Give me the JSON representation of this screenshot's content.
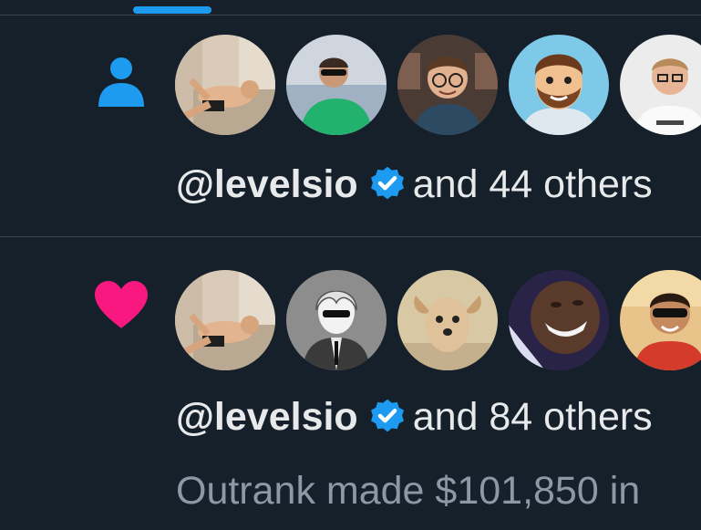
{
  "colors": {
    "background": "#15202b",
    "divider": "#38444d",
    "accent": "#1d9bf0",
    "heart": "#f91880",
    "text_primary": "#e7e9ea",
    "text_secondary": "#8b98a5"
  },
  "notifications": [
    {
      "type": "follow",
      "icon": "person-icon",
      "avatars": [
        {
          "name": "avatar-reclining-man"
        },
        {
          "name": "avatar-sunglasses-green-shirt"
        },
        {
          "name": "avatar-glasses-office"
        },
        {
          "name": "avatar-cartoon-bearded-man"
        },
        {
          "name": "avatar-man-glasses-white-shirt"
        }
      ],
      "user": "@levelsio",
      "verified_icon": "verified-badge-icon",
      "summary": "and 44 others"
    },
    {
      "type": "like",
      "icon": "heart-icon",
      "avatars": [
        {
          "name": "avatar-reclining-man"
        },
        {
          "name": "avatar-anime-suit-sunglasses"
        },
        {
          "name": "avatar-dog"
        },
        {
          "name": "avatar-man-grinning"
        },
        {
          "name": "avatar-cartoon-sunglasses"
        }
      ],
      "user": "@levelsio",
      "verified_icon": "verified-badge-icon",
      "summary": "and 84 others",
      "preview": "Outrank made $101,850 in"
    }
  ]
}
